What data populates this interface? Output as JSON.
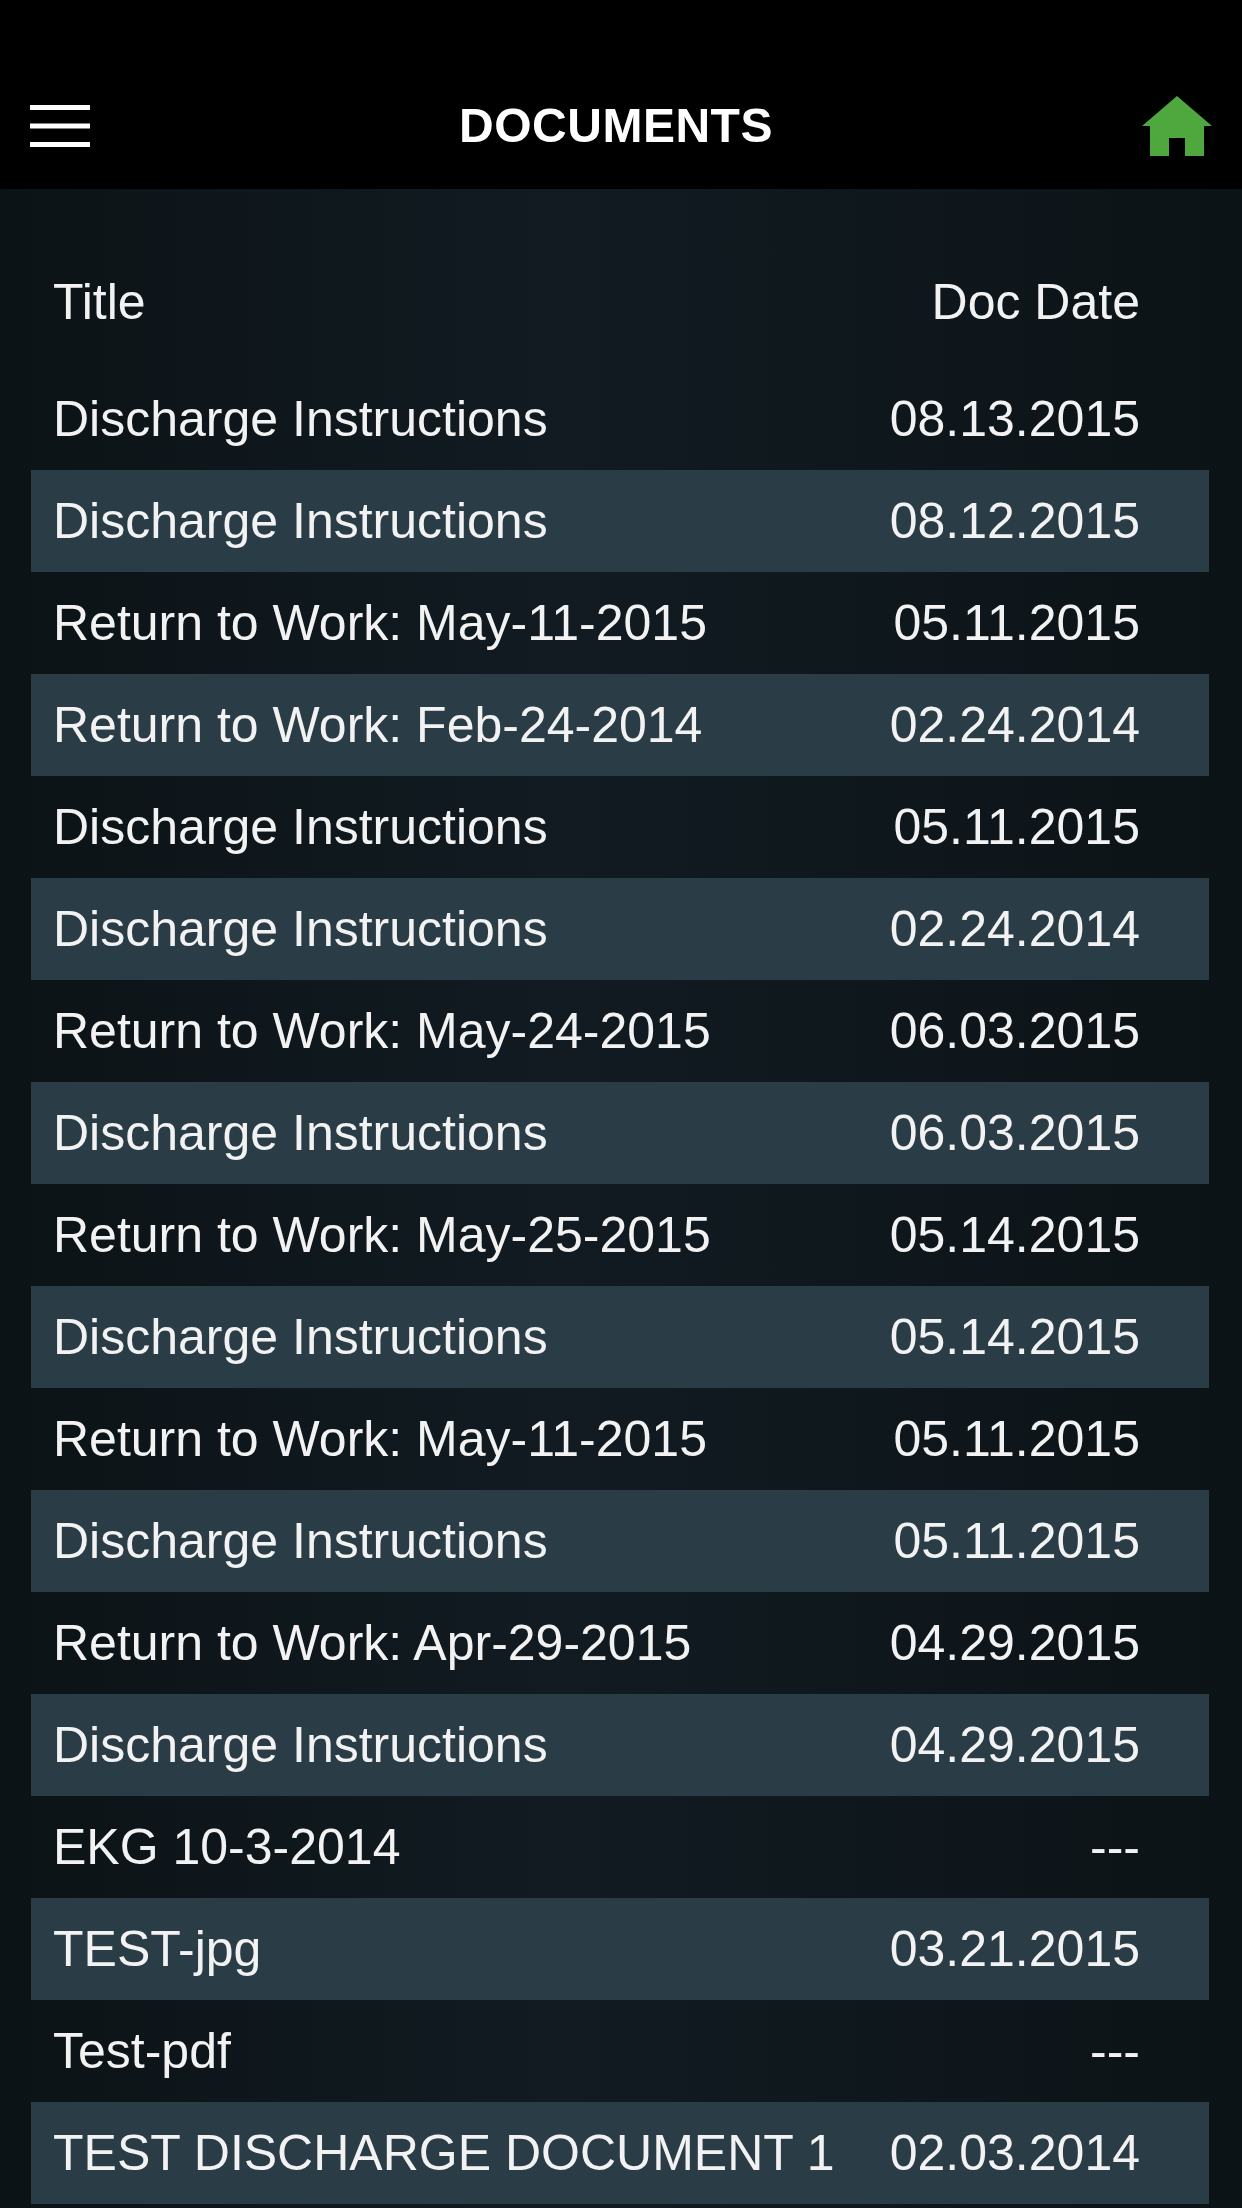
{
  "header": {
    "title": "DOCUMENTS"
  },
  "table": {
    "columns": [
      "Title",
      "Doc Date"
    ],
    "rows": [
      {
        "title": "Discharge Instructions",
        "doc_date": "08.13.2015"
      },
      {
        "title": "Discharge Instructions",
        "doc_date": "08.12.2015"
      },
      {
        "title": "Return to Work: May-11-2015",
        "doc_date": "05.11.2015"
      },
      {
        "title": "Return to Work: Feb-24-2014",
        "doc_date": "02.24.2014"
      },
      {
        "title": "Discharge Instructions",
        "doc_date": "05.11.2015"
      },
      {
        "title": "Discharge Instructions",
        "doc_date": "02.24.2014"
      },
      {
        "title": "Return to Work: May-24-2015",
        "doc_date": "06.03.2015"
      },
      {
        "title": "Discharge Instructions",
        "doc_date": "06.03.2015"
      },
      {
        "title": "Return to Work: May-25-2015",
        "doc_date": "05.14.2015"
      },
      {
        "title": "Discharge Instructions",
        "doc_date": "05.14.2015"
      },
      {
        "title": "Return to Work: May-11-2015",
        "doc_date": "05.11.2015"
      },
      {
        "title": "Discharge Instructions",
        "doc_date": "05.11.2015"
      },
      {
        "title": "Return to Work: Apr-29-2015",
        "doc_date": "04.29.2015"
      },
      {
        "title": "Discharge Instructions",
        "doc_date": "04.29.2015"
      },
      {
        "title": "EKG 10-3-2014",
        "doc_date": "---"
      },
      {
        "title": "TEST-jpg",
        "doc_date": "03.21.2015"
      },
      {
        "title": "Test-pdf",
        "doc_date": "---"
      },
      {
        "title": "TEST DISCHARGE DOCUMENT 1",
        "doc_date": "02.03.2014"
      }
    ]
  }
}
